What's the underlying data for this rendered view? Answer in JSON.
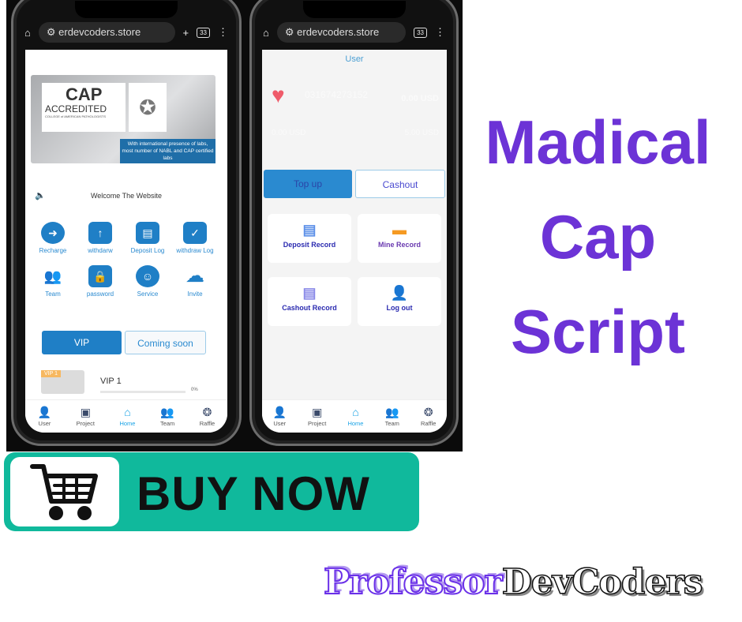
{
  "headline": {
    "line1": "Madical",
    "line2": "Cap",
    "line3": "Script",
    "color": "#6c33d6"
  },
  "buy_button": {
    "label": "BUY NOW",
    "icon": "shopping-cart-icon",
    "color": "#10b99c"
  },
  "brand": {
    "part1": "Professor",
    "part2": "DevCoders"
  },
  "browser": {
    "url": "erdevcoders.store",
    "tab_count": "33"
  },
  "home_screen": {
    "banner": {
      "logo_text": "CAP",
      "accredited": "ACCREDITED",
      "college": "COLLEGE of AMERICAN PATHOLOGISTS",
      "caption": "With international presence of labs, most number of NABL and CAP certified labs"
    },
    "welcome": "Welcome The Website",
    "actions": [
      {
        "label": "Recharge",
        "icon": "recharge-icon"
      },
      {
        "label": "withdarw",
        "icon": "withdraw-icon"
      },
      {
        "label": "Deposit Log",
        "icon": "deposit-log-icon"
      },
      {
        "label": "withdraw Log",
        "icon": "withdraw-log-icon"
      },
      {
        "label": "Team",
        "icon": "team-icon"
      },
      {
        "label": "password",
        "icon": "lock-icon"
      },
      {
        "label": "Service",
        "icon": "headset-icon"
      },
      {
        "label": "Invite",
        "icon": "cloud-icon"
      }
    ],
    "tabs": {
      "vip": "VIP",
      "coming": "Coming soon"
    },
    "vip_item": {
      "tag": "VIP 1",
      "title": "VIP 1",
      "progress": "0%"
    }
  },
  "user_screen": {
    "title": "User",
    "user_id": "031674273152",
    "balance": "0.00 USD",
    "left_value": "0.00 USD",
    "right_value": "5.00 USD",
    "topup": "Top up",
    "cashout": "Cashout",
    "cards": [
      {
        "label": "Deposit Record",
        "icon": "document-icon"
      },
      {
        "label": "Mine Record",
        "icon": "card-icon"
      },
      {
        "label": "Cashout Record",
        "icon": "cashout-record-icon"
      },
      {
        "label": "Log out",
        "icon": "logout-icon"
      }
    ]
  },
  "nav": [
    {
      "label": "User"
    },
    {
      "label": "Project"
    },
    {
      "label": "Home"
    },
    {
      "label": "Team"
    },
    {
      "label": "Raffle"
    }
  ]
}
